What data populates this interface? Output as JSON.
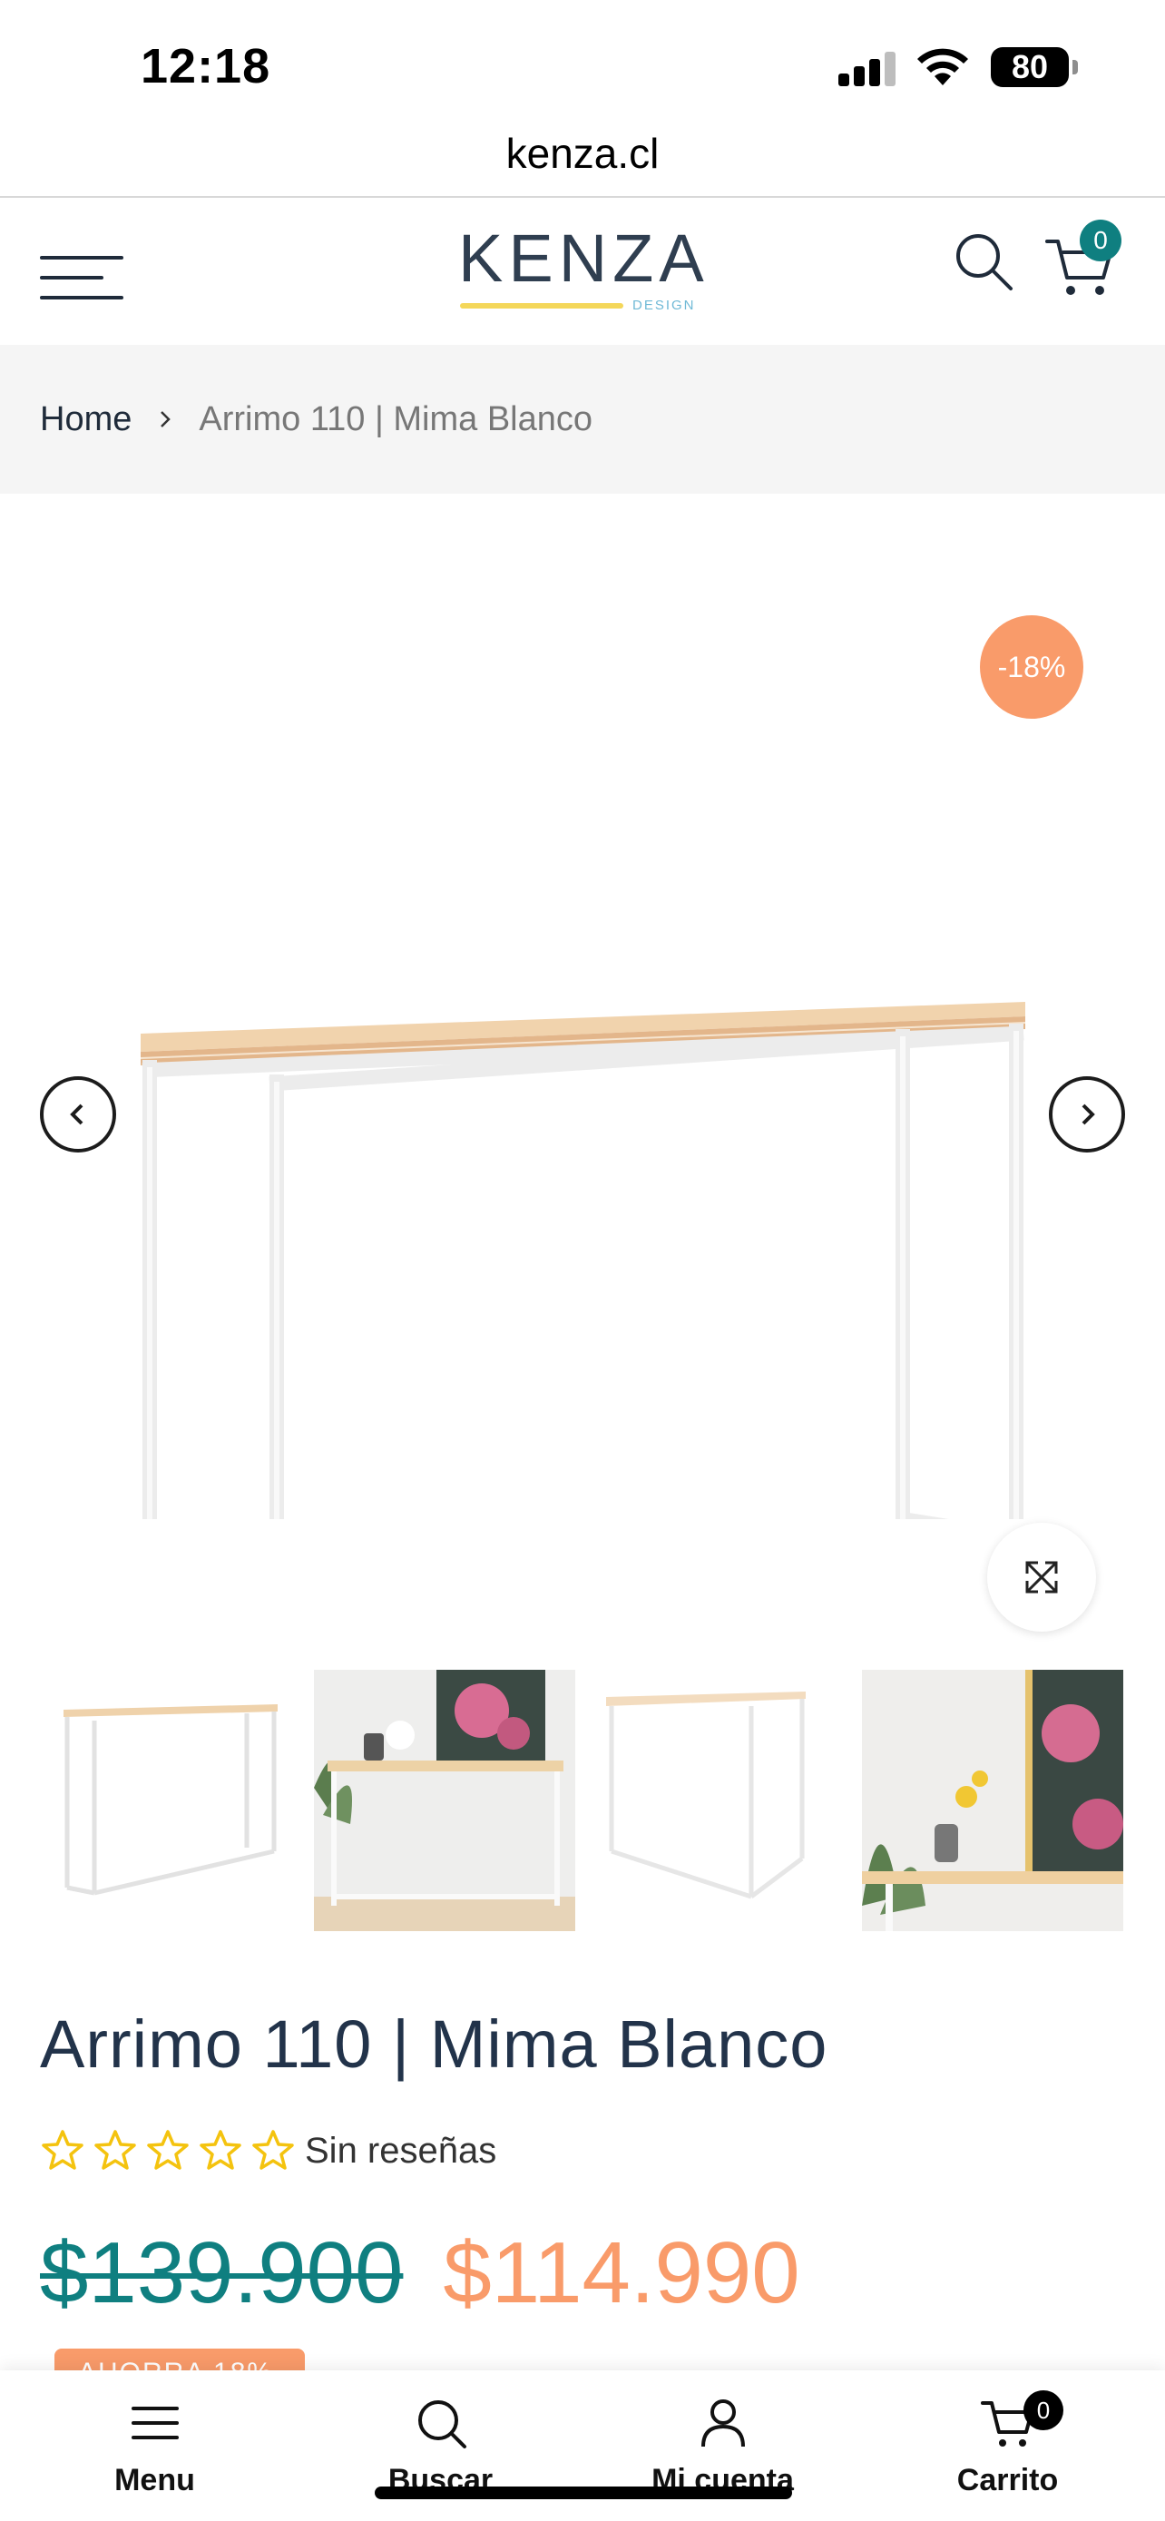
{
  "status_bar": {
    "time": "12:18",
    "battery": "80"
  },
  "browser": {
    "url": "kenza.cl"
  },
  "header": {
    "logo_text": "KENZA",
    "logo_sub": "DESIGN",
    "cart_count": "0"
  },
  "breadcrumb": {
    "home": "Home",
    "current": "Arrimo 110 | Mima Blanco"
  },
  "gallery": {
    "discount_badge": "-18%",
    "thumbnail_count": 4
  },
  "product": {
    "title": "Arrimo 110 | Mima Blanco",
    "rating": 0,
    "rating_max": 5,
    "reviews_text": "Sin reseñas",
    "price_old": "$139.900",
    "price_new": "$114.990",
    "save_badge": "AHORRA 18%"
  },
  "bottom_nav": {
    "items": [
      {
        "label": "Menu",
        "icon": "menu-icon"
      },
      {
        "label": "Buscar",
        "icon": "search-icon"
      },
      {
        "label": "Mi cuenta",
        "icon": "user-icon"
      },
      {
        "label": "Carrito",
        "icon": "cart-icon"
      }
    ],
    "cart_count": "0"
  },
  "colors": {
    "accent_teal": "#0f7f80",
    "accent_orange": "#f99b6a",
    "text_dark": "#22334a"
  }
}
